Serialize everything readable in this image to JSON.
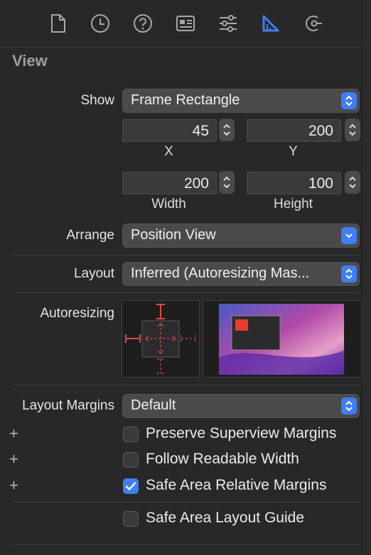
{
  "toolbar": {
    "icons": [
      "file-icon",
      "history-icon",
      "help-icon",
      "identity-icon",
      "attributes-icon",
      "size-inspector-icon",
      "connections-icon"
    ],
    "active": "size-inspector-icon",
    "accent": "#3f7ef5"
  },
  "section": {
    "title": "View"
  },
  "show": {
    "label": "Show",
    "value": "Frame Rectangle"
  },
  "frame": {
    "x": "45",
    "y": "200",
    "width": "200",
    "height": "100",
    "x_label": "X",
    "y_label": "Y",
    "width_label": "Width",
    "height_label": "Height"
  },
  "arrange": {
    "label": "Arrange",
    "value": "Position View"
  },
  "layout": {
    "label": "Layout",
    "value": "Inferred (Autoresizing Mas..."
  },
  "autoresizing": {
    "label": "Autoresizing",
    "strut_color": "#e04a3f"
  },
  "layout_margins": {
    "label": "Layout Margins",
    "value": "Default"
  },
  "options": [
    {
      "label": "Preserve Superview Margins",
      "checked": false,
      "plus": "+"
    },
    {
      "label": "Follow Readable Width",
      "checked": false,
      "plus": "+"
    },
    {
      "label": "Safe Area Relative Margins",
      "checked": true,
      "plus": "+"
    },
    {
      "label": "Safe Area Layout Guide",
      "checked": false,
      "plus": ""
    }
  ]
}
